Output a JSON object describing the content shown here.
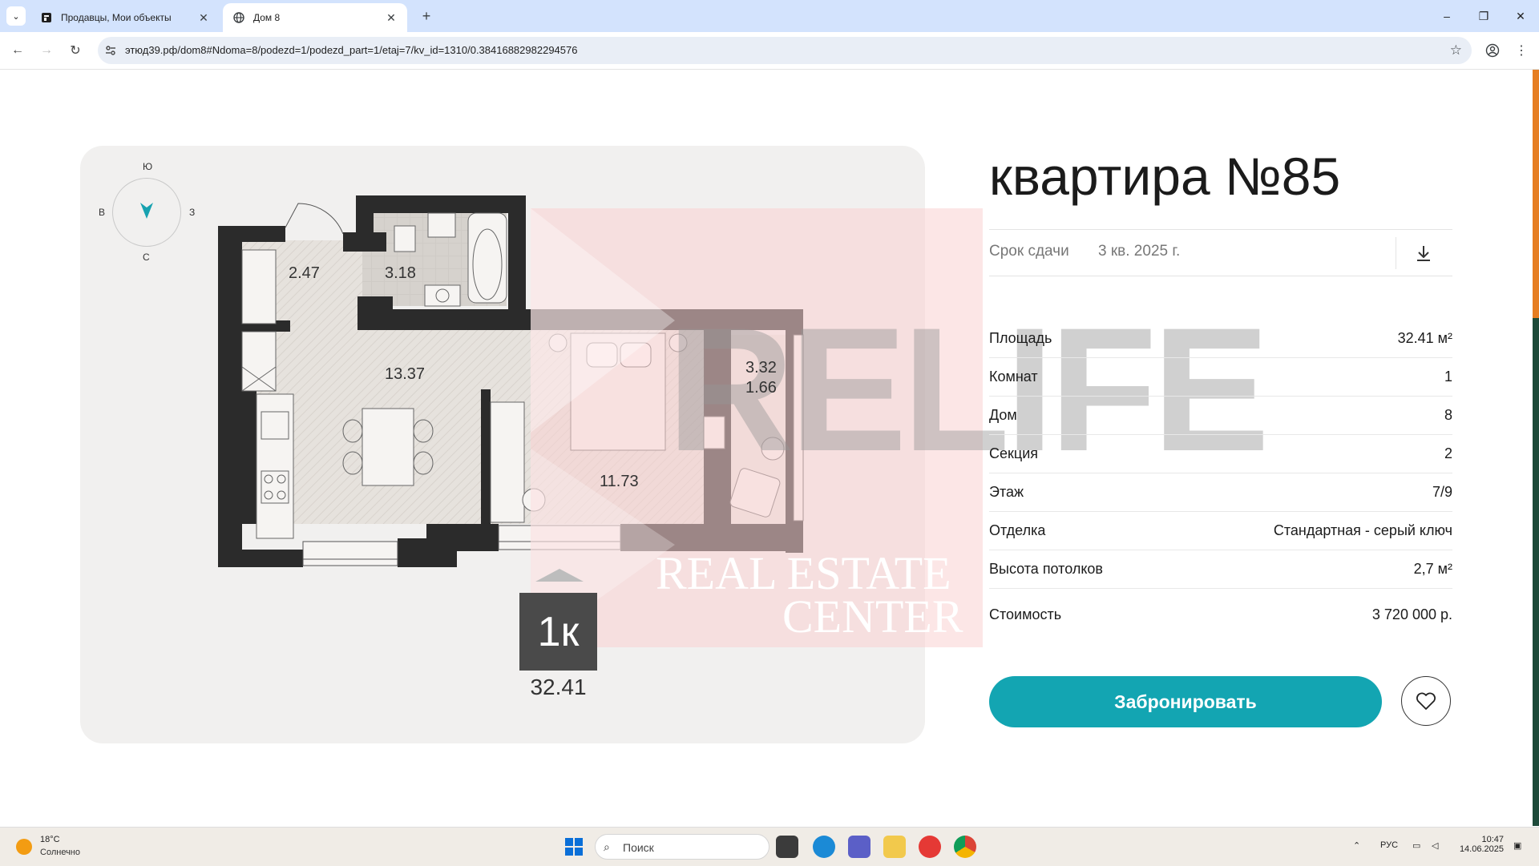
{
  "browser": {
    "tabs": [
      {
        "label": "Продавцы, Мои объекты",
        "active": false
      },
      {
        "label": "Дом 8",
        "active": true
      }
    ],
    "url": "этюд39.рф/dom8#Ndoma=8/podezd=1/podezd_part=1/etaj=7/kv_id=1310/0.38416882982294576",
    "window_controls": [
      "–",
      "❐",
      "✕"
    ]
  },
  "plan": {
    "compass": {
      "north": "С",
      "south": "Ю",
      "west": "В",
      "east": "З"
    },
    "rooms": [
      {
        "label": "2.47"
      },
      {
        "label": "3.18"
      },
      {
        "label": "13.37"
      },
      {
        "label": "11.73"
      },
      {
        "label": "3.32"
      },
      {
        "label": "1.66"
      }
    ],
    "watermark": {
      "brand": "RELIFE",
      "line1": "REAL ESTATE",
      "line2": "CENTER"
    },
    "badge": "1к",
    "total_area": "32.41"
  },
  "apartment": {
    "title": "квартира №85",
    "deadline_label": "Срок сдачи",
    "deadline_value": "3 кв. 2025 г.",
    "specs": [
      {
        "label": "Площадь",
        "value": "32.41 м²"
      },
      {
        "label": "Комнат",
        "value": "1"
      },
      {
        "label": "Дом",
        "value": "8"
      },
      {
        "label": "Секция",
        "value": "2"
      },
      {
        "label": "Этаж",
        "value": "7/9"
      },
      {
        "label": "Отделка",
        "value": "Стандартная - серый ключ"
      },
      {
        "label": "Высота потолков",
        "value": "2,7 м²"
      }
    ],
    "price_label": "Стоимость",
    "price_value": "3 720 000 р.",
    "book_label": "Забронировать"
  },
  "taskbar": {
    "weather_temp": "18°C",
    "weather_desc": "Солнечно",
    "search_placeholder": "Поиск",
    "lang": "РУС",
    "time": "10:47",
    "date": "14.06.2025"
  },
  "colors": {
    "accent": "#13a5b2",
    "tab_bar": "#d3e3fd",
    "card": "#f1f0ef",
    "wall": "#2b2b2b"
  }
}
